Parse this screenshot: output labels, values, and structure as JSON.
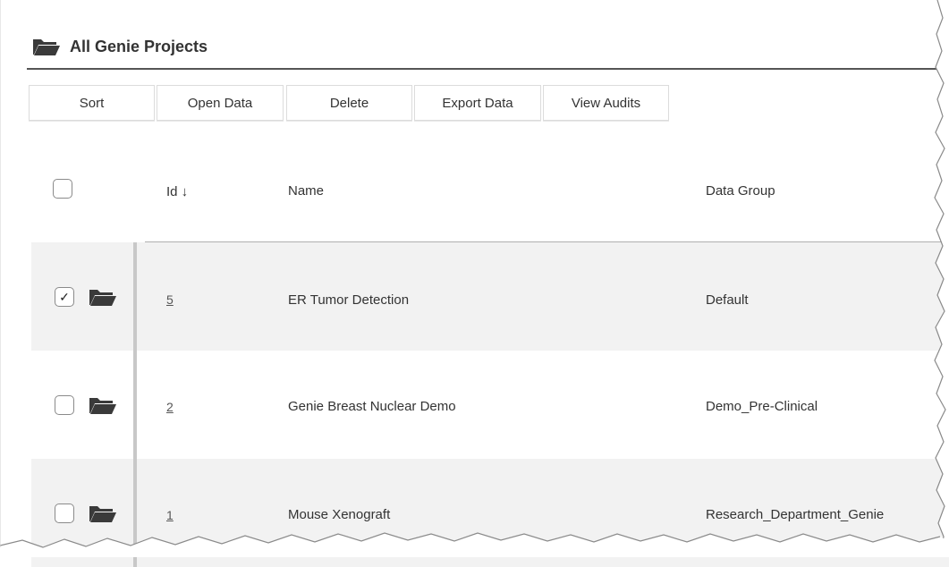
{
  "panel": {
    "title": "All Genie Projects",
    "icon": "folder-open-icon"
  },
  "toolbar": {
    "sort": "Sort",
    "open_data": "Open Data",
    "delete": "Delete",
    "export_data": "Export Data",
    "view_audits": "View Audits"
  },
  "table": {
    "headers": {
      "id": "Id ↓",
      "name": "Name",
      "data_group": "Data Group"
    },
    "rows": [
      {
        "id": "5",
        "name": "ER Tumor Detection",
        "data_group": "Default",
        "checked": true
      },
      {
        "id": "2",
        "name": "Genie Breast Nuclear Demo",
        "data_group": "Demo_Pre-Clinical",
        "checked": false
      },
      {
        "id": "1",
        "name": "Mouse Xenograft",
        "data_group": "Research_Department_Genie",
        "checked": false
      }
    ]
  },
  "colors": {
    "row_alt_bg": "#f2f2f2",
    "header_rule": "#555555",
    "row_divider": "#c8c8c8"
  }
}
